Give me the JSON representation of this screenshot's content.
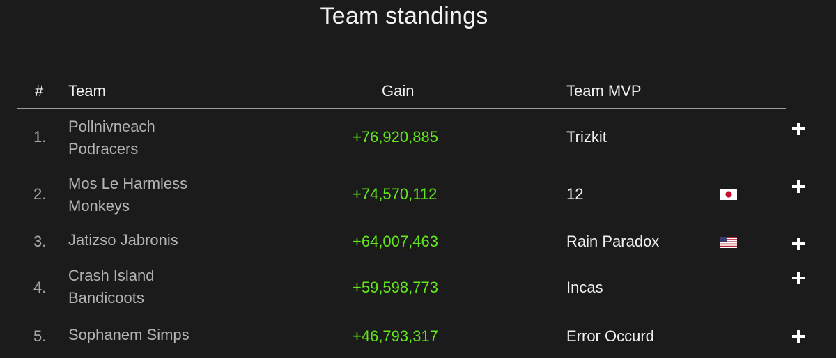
{
  "title": "Team standings",
  "columns": {
    "rank": "#",
    "team": "Team",
    "gain": "Gain",
    "mvp": "Team MVP"
  },
  "rows": [
    {
      "rank": "1.",
      "team_line1": "Pollnivneach",
      "team_line2": "Podracers",
      "gain": "+76,920,885",
      "mvp": "Trizkit",
      "flag": ""
    },
    {
      "rank": "2.",
      "team_line1": "Mos Le Harmless",
      "team_line2": "Monkeys",
      "gain": "+74,570,112",
      "mvp": "12",
      "flag": "japan-flag-icon"
    },
    {
      "rank": "3.",
      "team_line1": "Jatizso Jabronis",
      "team_line2": "",
      "gain": "+64,007,463",
      "mvp": "Rain Paradox",
      "flag": "usa-flag-icon"
    },
    {
      "rank": "4.",
      "team_line1": "Crash Island",
      "team_line2": "Bandicoots",
      "gain": "+59,598,773",
      "mvp": "Incas",
      "flag": ""
    },
    {
      "rank": "5.",
      "team_line1": "Sophanem Simps",
      "team_line2": "",
      "gain": "+46,793,317",
      "mvp": "Error Occurd",
      "flag": ""
    }
  ],
  "colors": {
    "background": "#1b1b1b",
    "gain": "#62e61c",
    "team_text": "#b4b4b4",
    "header_text": "#f0f0f0"
  }
}
